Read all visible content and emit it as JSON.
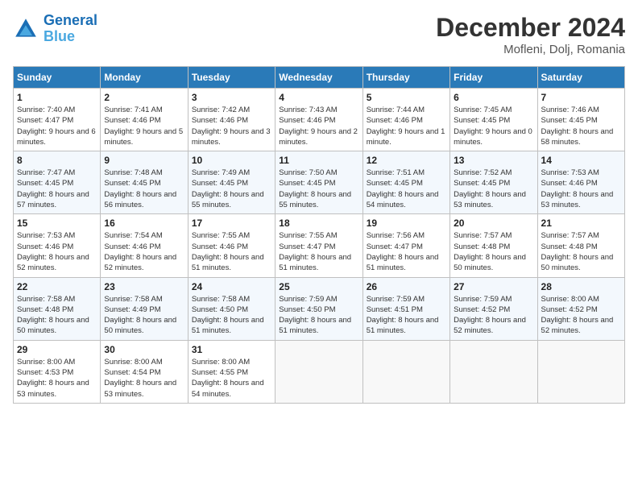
{
  "header": {
    "logo_line1": "General",
    "logo_line2": "Blue",
    "month_year": "December 2024",
    "location": "Mofleni, Dolj, Romania"
  },
  "weekdays": [
    "Sunday",
    "Monday",
    "Tuesday",
    "Wednesday",
    "Thursday",
    "Friday",
    "Saturday"
  ],
  "weeks": [
    [
      {
        "day": "1",
        "sunrise": "7:40 AM",
        "sunset": "4:47 PM",
        "daylight": "9 hours and 6 minutes."
      },
      {
        "day": "2",
        "sunrise": "7:41 AM",
        "sunset": "4:46 PM",
        "daylight": "9 hours and 5 minutes."
      },
      {
        "day": "3",
        "sunrise": "7:42 AM",
        "sunset": "4:46 PM",
        "daylight": "9 hours and 3 minutes."
      },
      {
        "day": "4",
        "sunrise": "7:43 AM",
        "sunset": "4:46 PM",
        "daylight": "9 hours and 2 minutes."
      },
      {
        "day": "5",
        "sunrise": "7:44 AM",
        "sunset": "4:46 PM",
        "daylight": "9 hours and 1 minute."
      },
      {
        "day": "6",
        "sunrise": "7:45 AM",
        "sunset": "4:45 PM",
        "daylight": "9 hours and 0 minutes."
      },
      {
        "day": "7",
        "sunrise": "7:46 AM",
        "sunset": "4:45 PM",
        "daylight": "8 hours and 58 minutes."
      }
    ],
    [
      {
        "day": "8",
        "sunrise": "7:47 AM",
        "sunset": "4:45 PM",
        "daylight": "8 hours and 57 minutes."
      },
      {
        "day": "9",
        "sunrise": "7:48 AM",
        "sunset": "4:45 PM",
        "daylight": "8 hours and 56 minutes."
      },
      {
        "day": "10",
        "sunrise": "7:49 AM",
        "sunset": "4:45 PM",
        "daylight": "8 hours and 55 minutes."
      },
      {
        "day": "11",
        "sunrise": "7:50 AM",
        "sunset": "4:45 PM",
        "daylight": "8 hours and 55 minutes."
      },
      {
        "day": "12",
        "sunrise": "7:51 AM",
        "sunset": "4:45 PM",
        "daylight": "8 hours and 54 minutes."
      },
      {
        "day": "13",
        "sunrise": "7:52 AM",
        "sunset": "4:45 PM",
        "daylight": "8 hours and 53 minutes."
      },
      {
        "day": "14",
        "sunrise": "7:53 AM",
        "sunset": "4:46 PM",
        "daylight": "8 hours and 53 minutes."
      }
    ],
    [
      {
        "day": "15",
        "sunrise": "7:53 AM",
        "sunset": "4:46 PM",
        "daylight": "8 hours and 52 minutes."
      },
      {
        "day": "16",
        "sunrise": "7:54 AM",
        "sunset": "4:46 PM",
        "daylight": "8 hours and 52 minutes."
      },
      {
        "day": "17",
        "sunrise": "7:55 AM",
        "sunset": "4:46 PM",
        "daylight": "8 hours and 51 minutes."
      },
      {
        "day": "18",
        "sunrise": "7:55 AM",
        "sunset": "4:47 PM",
        "daylight": "8 hours and 51 minutes."
      },
      {
        "day": "19",
        "sunrise": "7:56 AM",
        "sunset": "4:47 PM",
        "daylight": "8 hours and 51 minutes."
      },
      {
        "day": "20",
        "sunrise": "7:57 AM",
        "sunset": "4:48 PM",
        "daylight": "8 hours and 50 minutes."
      },
      {
        "day": "21",
        "sunrise": "7:57 AM",
        "sunset": "4:48 PM",
        "daylight": "8 hours and 50 minutes."
      }
    ],
    [
      {
        "day": "22",
        "sunrise": "7:58 AM",
        "sunset": "4:48 PM",
        "daylight": "8 hours and 50 minutes."
      },
      {
        "day": "23",
        "sunrise": "7:58 AM",
        "sunset": "4:49 PM",
        "daylight": "8 hours and 50 minutes."
      },
      {
        "day": "24",
        "sunrise": "7:58 AM",
        "sunset": "4:50 PM",
        "daylight": "8 hours and 51 minutes."
      },
      {
        "day": "25",
        "sunrise": "7:59 AM",
        "sunset": "4:50 PM",
        "daylight": "8 hours and 51 minutes."
      },
      {
        "day": "26",
        "sunrise": "7:59 AM",
        "sunset": "4:51 PM",
        "daylight": "8 hours and 51 minutes."
      },
      {
        "day": "27",
        "sunrise": "7:59 AM",
        "sunset": "4:52 PM",
        "daylight": "8 hours and 52 minutes."
      },
      {
        "day": "28",
        "sunrise": "8:00 AM",
        "sunset": "4:52 PM",
        "daylight": "8 hours and 52 minutes."
      }
    ],
    [
      {
        "day": "29",
        "sunrise": "8:00 AM",
        "sunset": "4:53 PM",
        "daylight": "8 hours and 53 minutes."
      },
      {
        "day": "30",
        "sunrise": "8:00 AM",
        "sunset": "4:54 PM",
        "daylight": "8 hours and 53 minutes."
      },
      {
        "day": "31",
        "sunrise": "8:00 AM",
        "sunset": "4:55 PM",
        "daylight": "8 hours and 54 minutes."
      },
      null,
      null,
      null,
      null
    ]
  ]
}
